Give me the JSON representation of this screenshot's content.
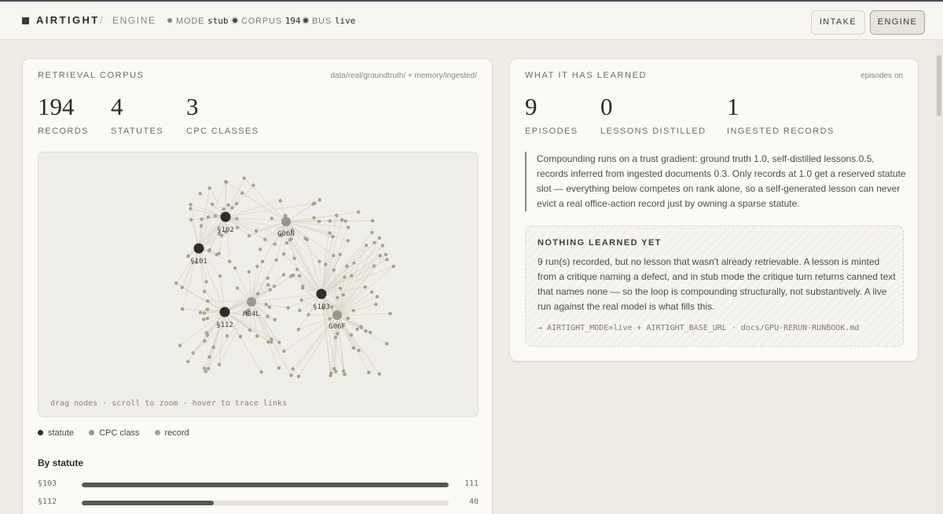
{
  "topbar": {
    "brand": "AIRTIGHT",
    "separator": "/",
    "section": "ENGINE",
    "status": [
      {
        "label": "MODE",
        "value": "stub",
        "color": "#8a877d"
      },
      {
        "label": "CORPUS",
        "value": "194",
        "color": "#4a4a44"
      },
      {
        "label": "BUS",
        "value": "live",
        "color": "#4a4a44"
      }
    ],
    "nav": [
      {
        "label": "INTAKE",
        "active": false
      },
      {
        "label": "ENGINE",
        "active": true
      }
    ]
  },
  "corpus": {
    "title": "RETRIEVAL CORPUS",
    "source": "data/real/groundtruth/ + memory/ingested/",
    "stats": [
      {
        "value": "194",
        "label": "RECORDS"
      },
      {
        "value": "4",
        "label": "STATUTES"
      },
      {
        "value": "3",
        "label": "CPC CLASSES"
      }
    ],
    "graph": {
      "hint": "drag nodes · scroll to zoom · hover to trace links",
      "colors": {
        "statute": "#2f2d28",
        "cpc": "#9a978a",
        "record": "#a3a58a",
        "edge": "#dcd7cb"
      },
      "statutes": [
        "§102",
        "§101",
        "§112",
        "§103"
      ],
      "cpc_classes": [
        "G06N",
        "H04L",
        "G06F"
      ]
    },
    "legend": [
      {
        "label": "statute",
        "color": "#2f2d28"
      },
      {
        "label": "CPC class",
        "color": "#9a978a"
      },
      {
        "label": "record",
        "color": "#a3a58a"
      }
    ],
    "by_statute_title": "By statute",
    "by_statute": [
      {
        "label": "§103",
        "count": "111",
        "fraction": 1.0
      },
      {
        "label": "§112",
        "count": "40",
        "fraction": 0.36
      }
    ]
  },
  "learned": {
    "title": "WHAT IT HAS LEARNED",
    "meta": "episodes on",
    "stats": [
      {
        "value": "9",
        "label": "EPISODES"
      },
      {
        "value": "0",
        "label": "LESSONS DISTILLED"
      },
      {
        "value": "1",
        "label": "INGESTED RECORDS"
      }
    ],
    "note": "Compounding runs on a trust gradient: ground truth 1.0, self-distilled lessons 0.5, records inferred from ingested documents 0.3. Only records at 1.0 get a reserved statute slot — everything below competes on rank alone, so a self-generated lesson can never evict a real office-action record just by owning a sparse statute.",
    "empty_title": "NOTHING LEARNED YET",
    "empty_text": "9 run(s) recorded, but no lesson that wasn't already retrievable. A lesson is minted from a critique naming a defect, and in stub mode the critique turn returns canned text that names none — so the loop is compounding structurally, not substantively. A live run against the real model is what fills this.",
    "empty_cmd": "→ AIRTIGHT_MODE=live + AIRTIGHT_BASE_URL · docs/GPU-RERUN-RUNBOOK.md"
  }
}
